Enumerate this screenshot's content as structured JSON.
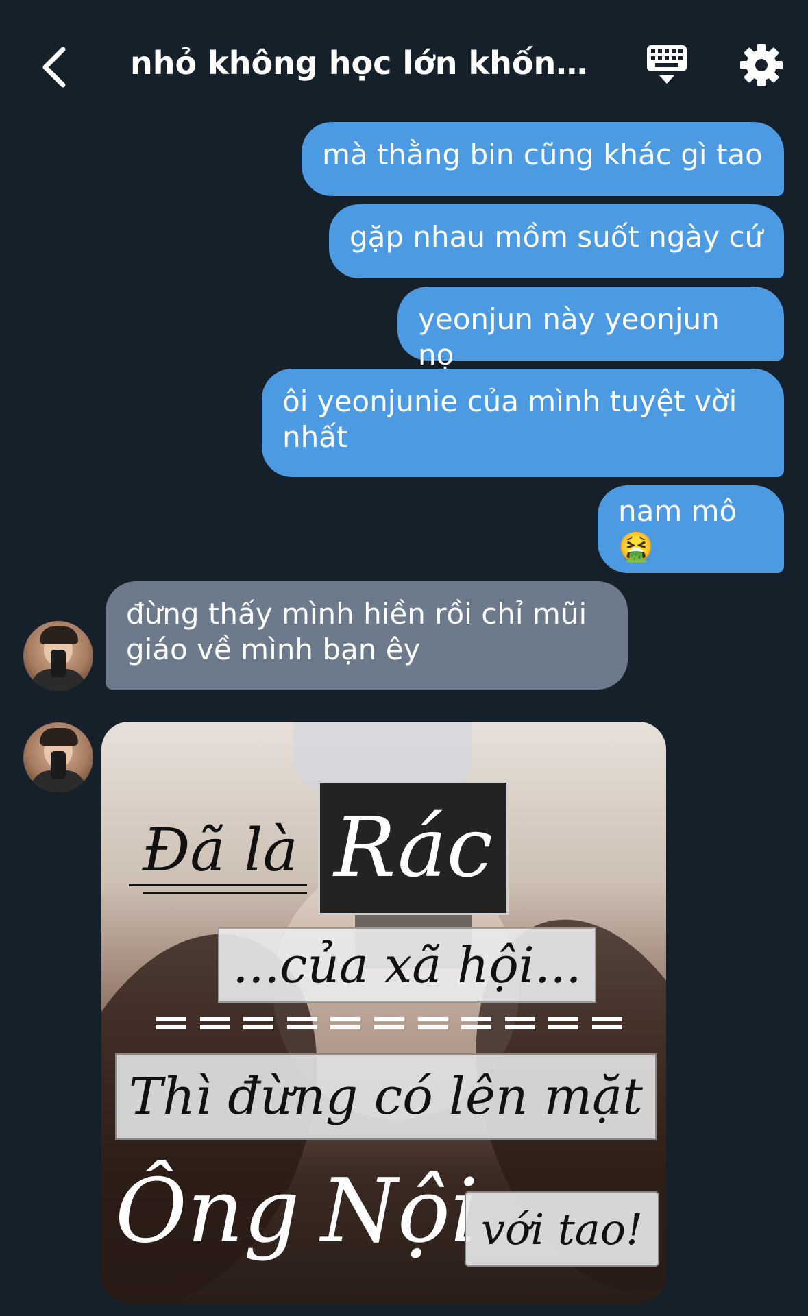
{
  "header": {
    "title": "nhỏ không học lớn khốn ...",
    "back_icon": "chevron-left-icon",
    "keyboard_icon": "keyboard-icon",
    "settings_icon": "gear-icon"
  },
  "messages": [
    {
      "direction": "outgoing",
      "text": "mà thằng bin cũng khác gì tao"
    },
    {
      "direction": "outgoing",
      "text": "gặp nhau mồm suốt ngày cứ"
    },
    {
      "direction": "outgoing",
      "text": "yeonjun này yeonjun nọ"
    },
    {
      "direction": "outgoing",
      "text": "ôi yeonjunie của mình tuyệt vời nhất"
    },
    {
      "direction": "outgoing",
      "text": "nam mô🤮"
    },
    {
      "direction": "incoming",
      "text": "đừng thấy mình hiền rồi chỉ mũi giáo về mình bạn êy"
    }
  ],
  "meme": {
    "line1": "Đã là",
    "line2": "Rác",
    "line3": "...của xã hội...",
    "line4": "Thì đừng có lên mặt",
    "line5": "Ông",
    "line6": "Nội",
    "line7": "với tao!"
  },
  "colors": {
    "background": "#16202b",
    "outgoing_bubble": "#4b9ae2",
    "incoming_bubble": "#6c7a8b"
  }
}
